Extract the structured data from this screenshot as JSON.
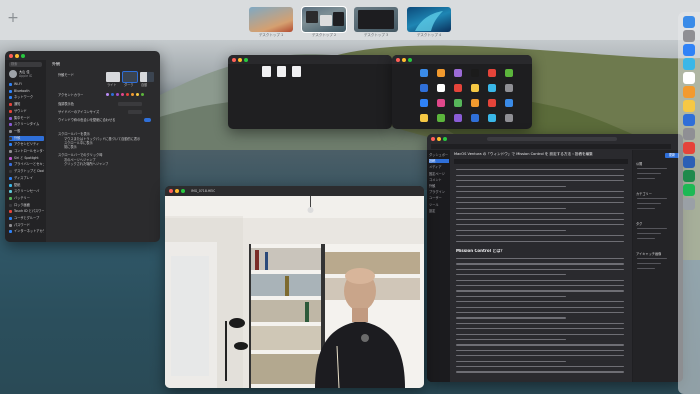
{
  "desktop": {
    "add_space_label": "+"
  },
  "spaces": [
    {
      "label": "デスクトップ 1",
      "active": false
    },
    {
      "label": "デスクトップ 2",
      "active": true
    },
    {
      "label": "デスクトップ 3",
      "active": false
    },
    {
      "label": "デスクトップ 4",
      "active": false
    }
  ],
  "settings_window": {
    "search_placeholder": "検索",
    "user_name": "大山 佳",
    "user_sub": "Apple ID",
    "sidebar": [
      "Wi-Fi",
      "Bluetooth",
      "ネットワーク",
      "通知",
      "サウンド",
      "集中モード",
      "スクリーンタイム",
      "一般",
      "外観",
      "アクセシビリティ",
      "コントロールセンター",
      "Siri と Spotlight",
      "プライバシーとセキュリティ",
      "デスクトップと Dock",
      "ディスプレイ",
      "壁紙",
      "スクリーンセーバ",
      "バッテリー",
      "ロック画面",
      "Touch ID とパスワード",
      "ユーザとグループ",
      "パスワード",
      "インターネットアカウント"
    ],
    "selected_index": 8,
    "pane_title": "外観",
    "rows": [
      "外観モード",
      "アクセントカラー",
      "強調表示色",
      "サイドバーのアイコンサイズ",
      "ウインドウ枠の色合いを壁紙に合わせる",
      "スクロールバーを表示",
      "スクロールバーでのクリック時"
    ],
    "options": [
      "ライト",
      "ダーク",
      "自動"
    ],
    "radio": [
      "マウスまたはトラックパッドに基づいて自動的に表示",
      "スクロール中に表示",
      "常に表示"
    ],
    "radio2": [
      "次のページへジャンプ",
      "クリックされた場所へジャンプ"
    ]
  },
  "editor_window": {
    "title": "MacOS Ventura の「ウィンドウ」で Mission Control を 設定する方法 ‹ 投稿を編集",
    "heading": "Mission Control とは？",
    "sidebar": [
      "ダッシュボード",
      "投稿",
      "メディア",
      "固定ページ",
      "コメント",
      "外観",
      "プラグイン",
      "ユーザー",
      "ツール",
      "設定"
    ],
    "right_panel": [
      "公開",
      "カテゴリー",
      "タグ",
      "アイキャッチ画像"
    ],
    "publish_button": "更新"
  },
  "photo_window": {
    "title": "IMG_0718.HEIC"
  },
  "colors": {
    "accent": "#2f6fd8",
    "window_dark": "#2b2b2d",
    "sea": "#2f5666"
  },
  "dock_icons": [
    "finder-icon",
    "launchpad-icon",
    "safari-icon",
    "mail-icon",
    "calendar-icon",
    "photos-icon",
    "notes-icon",
    "app-store-icon",
    "settings-icon",
    "chrome-icon",
    "word-icon",
    "excel-icon",
    "spotify-icon",
    "trash-icon"
  ]
}
